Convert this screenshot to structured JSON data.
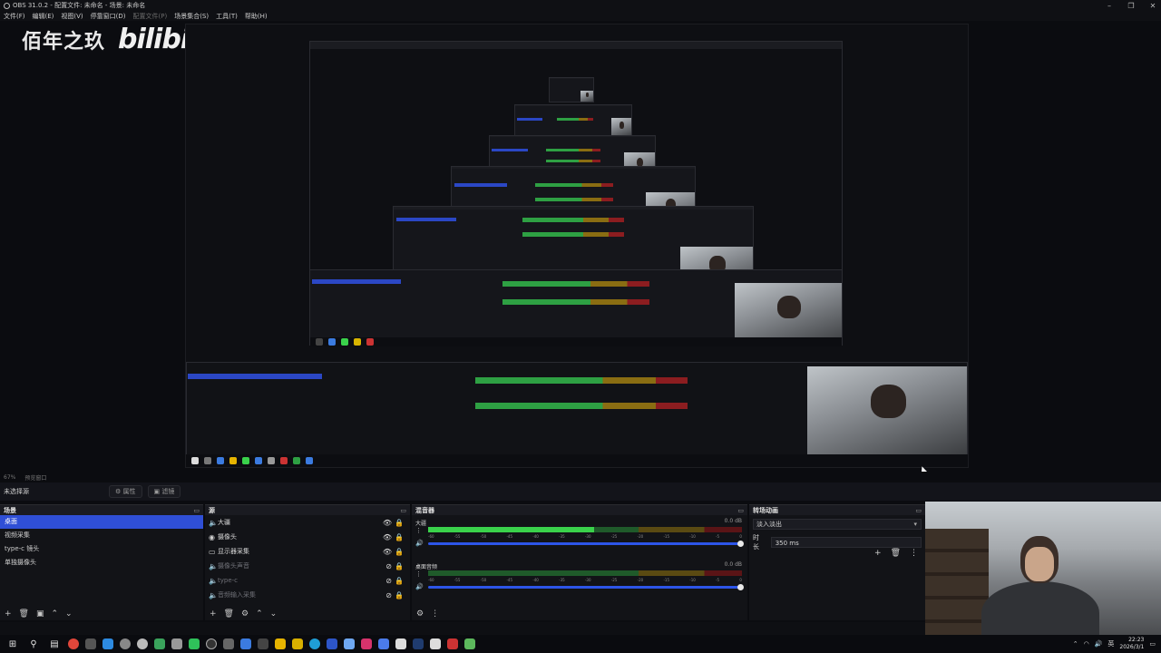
{
  "window": {
    "title": "OBS 31.0.2 - 配置文件: 未命名 - 场景: 未命名"
  },
  "menu": {
    "items": [
      "文件(F)",
      "编辑(E)",
      "视图(V)",
      "停靠窗口(D)",
      "配置文件(P)",
      "场景集合(S)",
      "工具(T)",
      "帮助(H)"
    ]
  },
  "watermark": {
    "text": "佰年之玖",
    "logo": "bilibili"
  },
  "strip": {
    "zoom": "67%",
    "mode": "预览窗口"
  },
  "source_toolbar": {
    "no_source": "未选择源",
    "properties": "属性",
    "filters": "滤镜"
  },
  "scenes": {
    "title": "场景",
    "items": [
      "桌面",
      "视频采集",
      "type-c 镜头",
      "单独摄像头"
    ],
    "selected_index": 0
  },
  "sources": {
    "title": "源",
    "items": [
      {
        "icon": "speaker-icon",
        "label": "大疆",
        "dim": false
      },
      {
        "icon": "camera-icon",
        "label": "摄像头",
        "dim": false
      },
      {
        "icon": "monitor-icon",
        "label": "显示器采集",
        "dim": false
      },
      {
        "icon": "speaker-icon",
        "label": "摄像头声音",
        "dim": true
      },
      {
        "icon": "speaker-icon",
        "label": "type-c",
        "dim": true
      },
      {
        "icon": "speaker-icon",
        "label": "音频输入采集",
        "dim": true
      }
    ]
  },
  "mixer": {
    "title": "混音器",
    "tracks": [
      {
        "name": "大疆",
        "db": "0.0 dB",
        "level": 0.53
      },
      {
        "name": "桌面音频",
        "db": "0.0 dB",
        "level": 0.0
      }
    ],
    "ticks": [
      "-60",
      "-55",
      "-50",
      "-45",
      "-40",
      "-35",
      "-30",
      "-25",
      "-20",
      "-15",
      "-10",
      "-5",
      "0"
    ]
  },
  "transitions": {
    "title": "转场动画",
    "selected": "淡入淡出",
    "duration_label": "时长",
    "duration_value": "350 ms"
  },
  "taskbar": {
    "lang": "英",
    "time": "22:23",
    "date": "2026/3/1"
  },
  "colors": {
    "accent": "#2f4fd6",
    "meter_green": "#3ad24b",
    "meter_yellow": "#8a6d12",
    "meter_red": "#8c1d20"
  }
}
